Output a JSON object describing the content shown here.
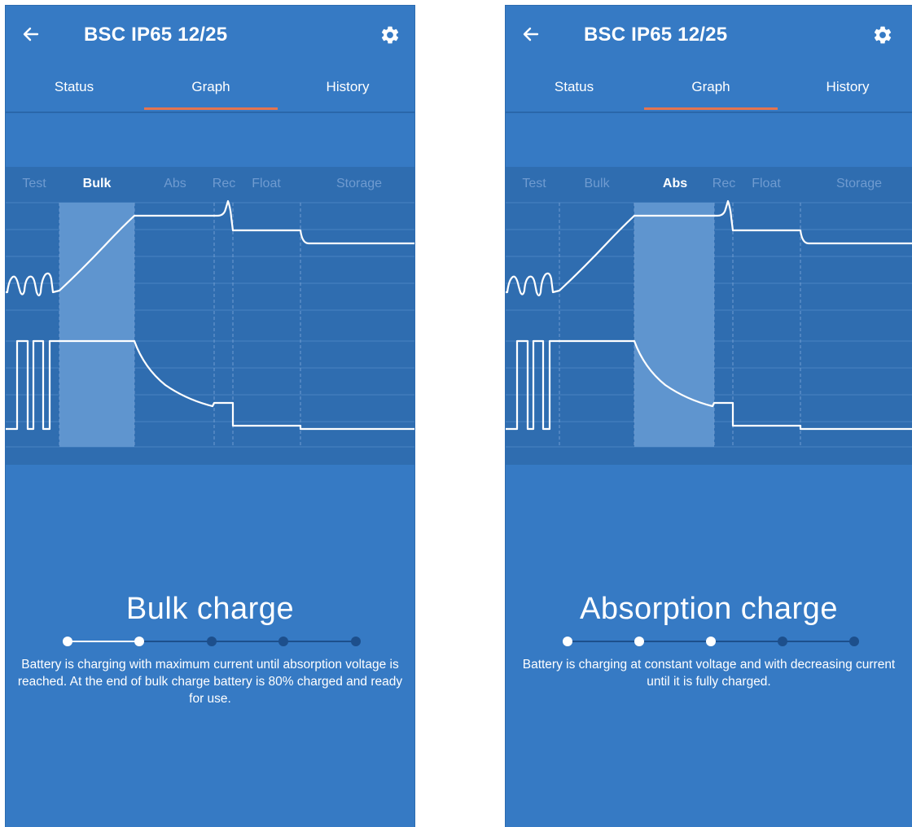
{
  "screens": [
    {
      "back_icon": "arrow-left-icon",
      "title": "BSC IP65 12/25",
      "settings_icon": "gear-icon",
      "tabs": [
        {
          "label": "Status",
          "active": false
        },
        {
          "label": "Graph",
          "active": true
        },
        {
          "label": "History",
          "active": false
        }
      ],
      "stages": [
        {
          "label": "Test",
          "active": false
        },
        {
          "label": "Bulk",
          "active": true
        },
        {
          "label": "Abs",
          "active": false
        },
        {
          "label": "Rec",
          "active": false
        },
        {
          "label": "Float",
          "active": false
        },
        {
          "label": "Storage",
          "active": false
        }
      ],
      "highlighted_stage": "Bulk",
      "stage_title": "Bulk charge",
      "progress_step": 2,
      "progress_total": 5,
      "description": "Battery is charging with maximum current until absorption voltage is reached. At the end of bulk charge battery is 80% charged and ready for use."
    },
    {
      "back_icon": "arrow-left-icon",
      "title": "BSC IP65 12/25",
      "settings_icon": "gear-icon",
      "tabs": [
        {
          "label": "Status",
          "active": false
        },
        {
          "label": "Graph",
          "active": true
        },
        {
          "label": "History",
          "active": false
        }
      ],
      "stages": [
        {
          "label": "Test",
          "active": false
        },
        {
          "label": "Bulk",
          "active": false
        },
        {
          "label": "Abs",
          "active": true
        },
        {
          "label": "Rec",
          "active": false
        },
        {
          "label": "Float",
          "active": false
        },
        {
          "label": "Storage",
          "active": false
        }
      ],
      "highlighted_stage": "Abs",
      "stage_title": "Absorption charge",
      "progress_step": 3,
      "progress_total": 5,
      "description": "Battery is charging at constant voltage and with decreasing current until it is fully charged."
    }
  ],
  "colors": {
    "background": "#367ac4",
    "graph_panel": "#2f6db0",
    "highlight": "#5f95cf",
    "accent": "#e5744f",
    "inactive_label": "#6f9bd0",
    "line": "#ffffff"
  }
}
